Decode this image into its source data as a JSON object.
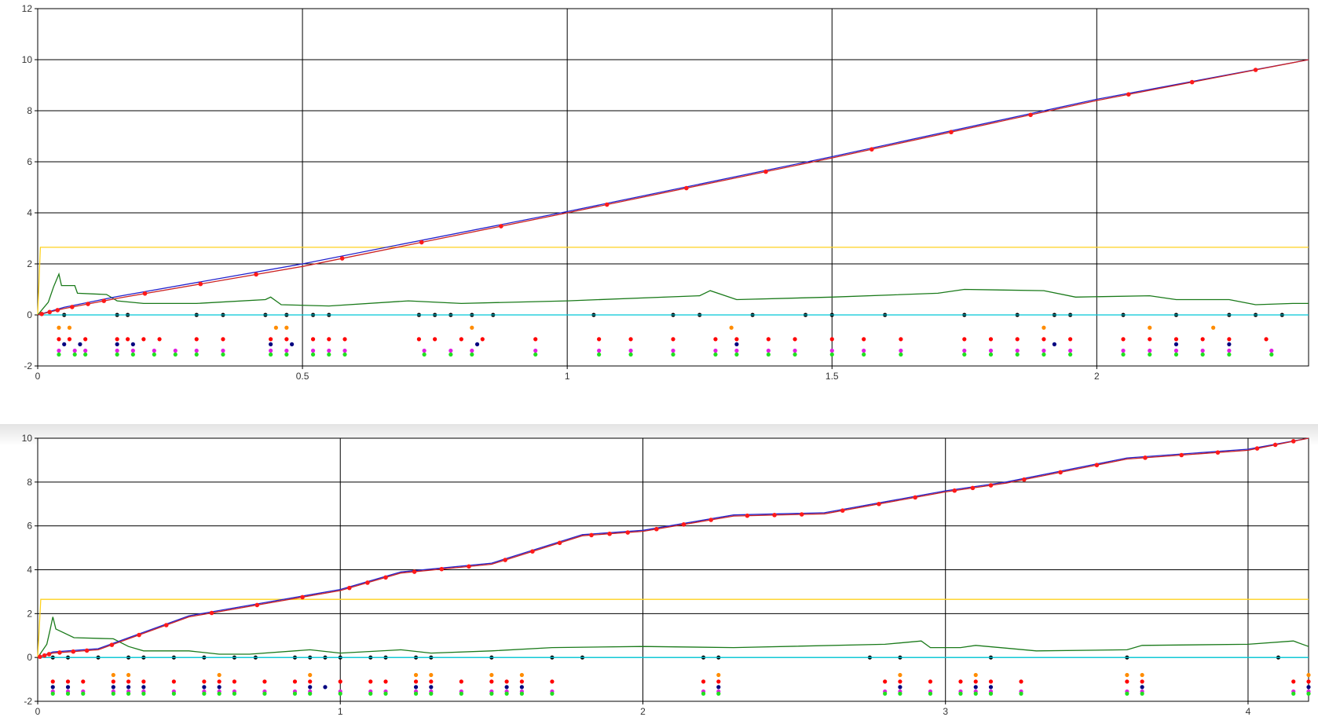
{
  "chart_data": [
    {
      "type": "line",
      "title": "",
      "xlabel": "",
      "ylabel": "",
      "xlim": [
        0,
        2.4
      ],
      "ylim": [
        -2,
        12
      ],
      "x_ticks": [
        "0",
        "0.5",
        "1",
        "1.5",
        "2"
      ],
      "x_tick_values": [
        0,
        0.5,
        1,
        1.5,
        2
      ],
      "y_ticks": [
        "-2",
        "0",
        "2",
        "4",
        "6",
        "8",
        "10",
        "12"
      ],
      "y_tick_values": [
        -2,
        0,
        2,
        4,
        6,
        8,
        10,
        12
      ],
      "grid": true,
      "series": [
        {
          "color": "#ffd21f",
          "points": [
            [
              0,
              0
            ],
            [
              0.005,
              2.65
            ],
            [
              2.4,
              2.65
            ]
          ]
        },
        {
          "color": "#1a7a1a",
          "points": [
            [
              0,
              0
            ],
            [
              0.02,
              0.5
            ],
            [
              0.03,
              1.1
            ],
            [
              0.04,
              1.6
            ],
            [
              0.045,
              1.15
            ],
            [
              0.07,
              1.15
            ],
            [
              0.075,
              0.85
            ],
            [
              0.13,
              0.8
            ],
            [
              0.15,
              0.55
            ],
            [
              0.2,
              0.45
            ],
            [
              0.3,
              0.45
            ],
            [
              0.43,
              0.6
            ],
            [
              0.44,
              0.7
            ],
            [
              0.46,
              0.4
            ],
            [
              0.55,
              0.35
            ],
            [
              0.7,
              0.55
            ],
            [
              0.8,
              0.45
            ],
            [
              1.0,
              0.55
            ],
            [
              1.25,
              0.75
            ],
            [
              1.27,
              0.95
            ],
            [
              1.32,
              0.6
            ],
            [
              1.5,
              0.7
            ],
            [
              1.7,
              0.85
            ],
            [
              1.75,
              1.0
            ],
            [
              1.9,
              0.95
            ],
            [
              1.96,
              0.7
            ],
            [
              2.1,
              0.75
            ],
            [
              2.15,
              0.6
            ],
            [
              2.25,
              0.6
            ],
            [
              2.3,
              0.4
            ],
            [
              2.37,
              0.45
            ],
            [
              2.4,
              0.45
            ]
          ]
        },
        {
          "color": "#00c8d8",
          "points": [
            [
              0,
              0
            ],
            [
              2.4,
              0
            ]
          ]
        },
        {
          "color": "#2222cc",
          "points": [
            [
              0,
              0
            ],
            [
              0.05,
              0.3
            ],
            [
              0.15,
              0.72
            ],
            [
              0.5,
              2.0
            ],
            [
              1.0,
              4.05
            ],
            [
              1.5,
              6.2
            ],
            [
              2.0,
              8.45
            ],
            [
              2.4,
              10.0
            ]
          ]
        },
        {
          "color": "#cc2222",
          "points": [
            [
              0,
              0
            ],
            [
              0.05,
              0.25
            ],
            [
              0.15,
              0.65
            ],
            [
              0.5,
              1.9
            ],
            [
              1.0,
              4.0
            ],
            [
              1.5,
              6.15
            ],
            [
              2.0,
              8.4
            ],
            [
              2.4,
              10.0
            ]
          ]
        }
      ],
      "event_rows": [
        {
          "color": "#000000",
          "y": 0,
          "x": [
            0.05,
            0.15,
            0.17,
            0.3,
            0.35,
            0.43,
            0.47,
            0.52,
            0.55,
            0.72,
            0.75,
            0.78,
            0.82,
            0.86,
            1.05,
            1.2,
            1.25,
            1.35,
            1.45,
            1.5,
            1.6,
            1.75,
            1.85,
            1.92,
            1.95,
            2.05,
            2.15,
            2.25,
            2.3,
            2.35
          ]
        },
        {
          "color": "#ff8c00",
          "y": -0.5,
          "x": [
            0.04,
            0.06,
            0.45,
            0.47,
            0.82,
            1.31,
            1.9,
            2.1,
            2.22
          ]
        },
        {
          "color": "#ff0000",
          "y": -0.95,
          "x": [
            0.04,
            0.06,
            0.09,
            0.15,
            0.17,
            0.2,
            0.23,
            0.3,
            0.35,
            0.44,
            0.47,
            0.52,
            0.55,
            0.58,
            0.72,
            0.75,
            0.8,
            0.84,
            0.94,
            1.06,
            1.12,
            1.2,
            1.28,
            1.32,
            1.38,
            1.43,
            1.5,
            1.56,
            1.63,
            1.75,
            1.8,
            1.85,
            1.9,
            1.95,
            2.05,
            2.1,
            2.15,
            2.2,
            2.25,
            2.32
          ]
        },
        {
          "color": "#000080",
          "y": -1.15,
          "x": [
            0.05,
            0.08,
            0.15,
            0.18,
            0.44,
            0.48,
            0.83,
            1.32,
            1.92,
            2.15,
            2.25
          ]
        },
        {
          "color": "#e020e0",
          "y": -1.4,
          "x": [
            0.04,
            0.07,
            0.09,
            0.15,
            0.18,
            0.22,
            0.26,
            0.3,
            0.35,
            0.44,
            0.47,
            0.52,
            0.55,
            0.58,
            0.73,
            0.78,
            0.82,
            0.94,
            1.06,
            1.12,
            1.2,
            1.28,
            1.32,
            1.38,
            1.43,
            1.5,
            1.56,
            1.63,
            1.75,
            1.8,
            1.85,
            1.9,
            1.95,
            2.05,
            2.1,
            2.15,
            2.2,
            2.25,
            2.33
          ]
        },
        {
          "color": "#20e020",
          "y": -1.55,
          "x": [
            0.04,
            0.07,
            0.09,
            0.15,
            0.18,
            0.22,
            0.26,
            0.3,
            0.35,
            0.44,
            0.47,
            0.52,
            0.55,
            0.58,
            0.73,
            0.78,
            0.82,
            0.94,
            1.06,
            1.12,
            1.2,
            1.28,
            1.32,
            1.38,
            1.43,
            1.5,
            1.56,
            1.63,
            1.75,
            1.8,
            1.85,
            1.9,
            1.95,
            2.05,
            2.1,
            2.15,
            2.2,
            2.25,
            2.33
          ]
        }
      ]
    },
    {
      "type": "line",
      "title": "",
      "xlabel": "",
      "ylabel": "",
      "xlim": [
        0,
        4.2
      ],
      "ylim": [
        -2,
        10
      ],
      "x_ticks": [
        "0",
        "1",
        "2",
        "3",
        "4"
      ],
      "x_tick_values": [
        0,
        1,
        2,
        3,
        4
      ],
      "y_ticks": [
        "-2",
        "0",
        "2",
        "4",
        "6",
        "8",
        "10"
      ],
      "y_tick_values": [
        -2,
        0,
        2,
        4,
        6,
        8,
        10
      ],
      "grid": true,
      "series": [
        {
          "color": "#ffd21f",
          "points": [
            [
              0,
              0
            ],
            [
              0.01,
              2.65
            ],
            [
              4.2,
              2.65
            ]
          ]
        },
        {
          "color": "#1a7a1a",
          "points": [
            [
              0,
              0
            ],
            [
              0.03,
              0.6
            ],
            [
              0.04,
              1.2
            ],
            [
              0.05,
              1.85
            ],
            [
              0.06,
              1.3
            ],
            [
              0.12,
              0.9
            ],
            [
              0.25,
              0.85
            ],
            [
              0.3,
              0.5
            ],
            [
              0.35,
              0.3
            ],
            [
              0.5,
              0.3
            ],
            [
              0.6,
              0.15
            ],
            [
              0.7,
              0.15
            ],
            [
              0.9,
              0.35
            ],
            [
              1.0,
              0.2
            ],
            [
              1.2,
              0.35
            ],
            [
              1.3,
              0.2
            ],
            [
              1.5,
              0.3
            ],
            [
              1.7,
              0.45
            ],
            [
              2.0,
              0.5
            ],
            [
              2.3,
              0.45
            ],
            [
              2.8,
              0.6
            ],
            [
              2.92,
              0.75
            ],
            [
              2.95,
              0.45
            ],
            [
              3.05,
              0.45
            ],
            [
              3.1,
              0.55
            ],
            [
              3.3,
              0.3
            ],
            [
              3.6,
              0.35
            ],
            [
              3.65,
              0.55
            ],
            [
              4.0,
              0.6
            ],
            [
              4.15,
              0.75
            ],
            [
              4.2,
              0.5
            ]
          ]
        },
        {
          "color": "#00c8d8",
          "points": [
            [
              0,
              0
            ],
            [
              4.2,
              0
            ]
          ]
        },
        {
          "color": "#2222cc",
          "points": [
            [
              0,
              0
            ],
            [
              0.05,
              0.25
            ],
            [
              0.2,
              0.4
            ],
            [
              0.5,
              1.9
            ],
            [
              1.0,
              3.1
            ],
            [
              1.2,
              3.9
            ],
            [
              1.5,
              4.3
            ],
            [
              1.8,
              5.6
            ],
            [
              2.0,
              5.8
            ],
            [
              2.3,
              6.5
            ],
            [
              2.6,
              6.6
            ],
            [
              3.0,
              7.6
            ],
            [
              3.2,
              8.0
            ],
            [
              3.6,
              9.1
            ],
            [
              4.0,
              9.5
            ],
            [
              4.2,
              10.0
            ]
          ]
        },
        {
          "color": "#cc2222",
          "points": [
            [
              0,
              0
            ],
            [
              0.05,
              0.2
            ],
            [
              0.2,
              0.35
            ],
            [
              0.5,
              1.85
            ],
            [
              1.0,
              3.05
            ],
            [
              1.2,
              3.85
            ],
            [
              1.5,
              4.25
            ],
            [
              1.8,
              5.55
            ],
            [
              2.0,
              5.75
            ],
            [
              2.3,
              6.45
            ],
            [
              2.6,
              6.55
            ],
            [
              3.0,
              7.55
            ],
            [
              3.2,
              7.95
            ],
            [
              3.6,
              9.05
            ],
            [
              4.0,
              9.45
            ],
            [
              4.2,
              10.0
            ]
          ]
        }
      ],
      "event_rows": [
        {
          "color": "#000000",
          "y": 0,
          "x": [
            0.05,
            0.1,
            0.2,
            0.3,
            0.35,
            0.45,
            0.55,
            0.65,
            0.72,
            0.85,
            0.9,
            0.95,
            1.0,
            1.1,
            1.15,
            1.25,
            1.3,
            1.5,
            1.7,
            1.8,
            2.2,
            2.25,
            2.75,
            2.85,
            3.15,
            3.6,
            4.1
          ]
        },
        {
          "color": "#ff8c00",
          "y": -0.8,
          "x": [
            0.25,
            0.3,
            0.6,
            0.9,
            1.25,
            1.3,
            1.5,
            1.6,
            2.25,
            2.85,
            3.1,
            3.6,
            3.65,
            4.2
          ]
        },
        {
          "color": "#ff0000",
          "y": -1.1,
          "x": [
            0.05,
            0.1,
            0.15,
            0.25,
            0.3,
            0.35,
            0.45,
            0.55,
            0.6,
            0.65,
            0.75,
            0.85,
            0.9,
            1.0,
            1.1,
            1.15,
            1.25,
            1.3,
            1.4,
            1.5,
            1.55,
            1.6,
            1.7,
            2.2,
            2.25,
            2.8,
            2.85,
            2.95,
            3.05,
            3.1,
            3.15,
            3.25,
            3.6,
            3.65,
            4.15,
            4.2
          ]
        },
        {
          "color": "#000080",
          "y": -1.35,
          "x": [
            0.05,
            0.1,
            0.25,
            0.3,
            0.35,
            0.55,
            0.6,
            0.9,
            0.95,
            1.25,
            1.3,
            1.55,
            1.6,
            2.25,
            2.85,
            3.1,
            3.15,
            3.65,
            4.2
          ]
        },
        {
          "color": "#e020e0",
          "y": -1.55,
          "x": [
            0.05,
            0.1,
            0.15,
            0.25,
            0.3,
            0.35,
            0.45,
            0.55,
            0.6,
            0.65,
            0.75,
            0.85,
            0.9,
            1.0,
            1.1,
            1.15,
            1.25,
            1.3,
            1.4,
            1.5,
            1.55,
            1.6,
            1.7,
            2.2,
            2.25,
            2.8,
            2.85,
            2.95,
            3.05,
            3.1,
            3.15,
            3.25,
            3.6,
            3.65,
            4.15,
            4.2
          ]
        },
        {
          "color": "#20e020",
          "y": -1.65,
          "x": [
            0.05,
            0.1,
            0.15,
            0.25,
            0.3,
            0.35,
            0.45,
            0.55,
            0.6,
            0.65,
            0.75,
            0.85,
            0.9,
            1.0,
            1.1,
            1.15,
            1.25,
            1.3,
            1.4,
            1.5,
            1.55,
            1.6,
            1.7,
            2.2,
            2.25,
            2.8,
            2.85,
            2.95,
            3.05,
            3.1,
            3.15,
            3.25,
            3.6,
            3.65,
            4.15,
            4.2
          ]
        }
      ]
    }
  ]
}
